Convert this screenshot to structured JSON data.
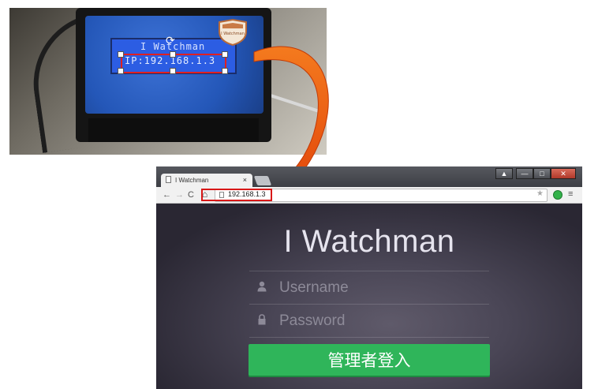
{
  "photo": {
    "lcd_line1": "I Watchman",
    "lcd_line2": "IP:192.168.1.3",
    "shield_text": "I Watchman"
  },
  "browser": {
    "tab_title": "I Watchman",
    "tab_close": "×",
    "url": "192.168.1.3",
    "window_buttons": {
      "user": "▲",
      "minimize": "—",
      "maximize": "□",
      "close": "✕"
    },
    "nav": {
      "back": "←",
      "forward": "→",
      "reload": "C",
      "home": "⌂",
      "star": "★",
      "menu": "≡"
    }
  },
  "login": {
    "title": "I Watchman",
    "username_placeholder": "Username",
    "password_placeholder": "Password",
    "login_button": "管理者登入"
  },
  "colors": {
    "accent_green": "#2fb55a",
    "highlight_red": "#d81818",
    "arrow_orange": "#f05a0a"
  }
}
